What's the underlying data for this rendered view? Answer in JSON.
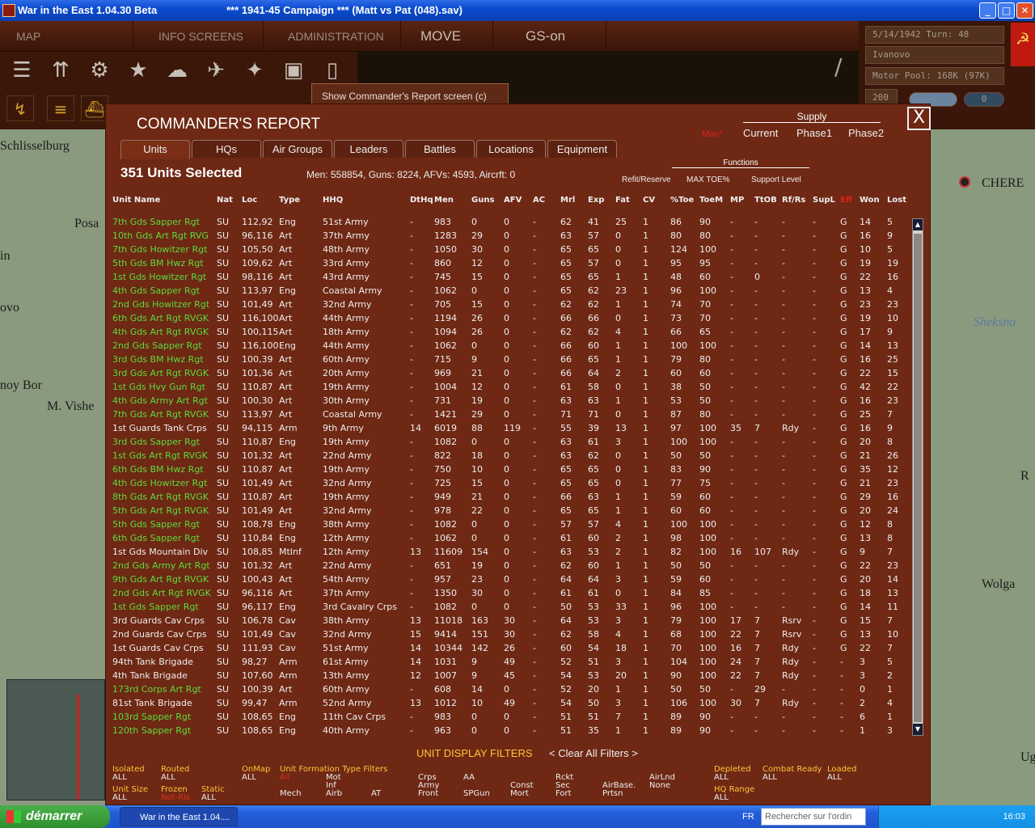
{
  "window": {
    "title_left": "War in the East 1.04.30 Beta",
    "title_right": "***   1941-45 Campaign   ***  (Matt vs Pat (048).sav)"
  },
  "menu": {
    "tabs": [
      "MAP INFORMATION",
      "INFO SCREENS",
      "ADMINISTRATION",
      "MOVE",
      "GS-on"
    ]
  },
  "status": {
    "date_turn": "5/14/1942     Turn: 48",
    "commander": "Ivanovo",
    "motor_pool": "Motor Pool: 168K (97K)",
    "value": "200",
    "counter": "0"
  },
  "tooltip": "Show Commander's Report screen (c)",
  "map": {
    "labels": [
      "Schlisselburg",
      "Posa",
      "ovo",
      "in",
      "noy Bor",
      "M. Vishe",
      "CHERE",
      "Sheksna",
      "Wolga",
      "R",
      "Ug"
    ]
  },
  "report": {
    "title": "COMMANDER'S REPORT",
    "close": "X",
    "supply_header": "Supply",
    "man": "Man*",
    "supply_cols": [
      "Current",
      "Phase1",
      "Phase2"
    ],
    "tabs": [
      "Units",
      "HQs",
      "Air Groups",
      "Leaders",
      "Battles",
      "Locations",
      "Equipment"
    ],
    "selected": "351 Units Selected",
    "totals": "Men: 558854, Guns: 8224, AFVs: 4593, Aircrft: 0",
    "functions_header": "Functions",
    "functions": [
      "Refit/Reserve",
      "MAX TOE%",
      "Support Level"
    ],
    "columns": [
      "Unit Name",
      "Nat",
      "Loc",
      "Type",
      "HHQ",
      "DtHq",
      "Men",
      "Guns",
      "AFV",
      "AC",
      "Mrl",
      "Exp",
      "Fat",
      "CV",
      "%Toe",
      "ToeM",
      "MP",
      "TtOB",
      "Rf/Rs",
      "SupL",
      "Eff",
      "Won",
      "Lost"
    ],
    "rows": [
      [
        "7th Gds Sapper Rgt",
        "SU",
        "112,92",
        "Eng",
        "51st Army",
        "-",
        "983",
        "0",
        "0",
        "-",
        "62",
        "41",
        "25",
        "1",
        "86",
        "90",
        "-",
        "-",
        "-",
        "-",
        "G",
        "14",
        "5"
      ],
      [
        "10th Gds Art Rgt RVG",
        "SU",
        "96,116",
        "Art",
        "37th Army",
        "-",
        "1283",
        "29",
        "0",
        "-",
        "63",
        "57",
        "0",
        "1",
        "80",
        "80",
        "-",
        "-",
        "-",
        "-",
        "G",
        "16",
        "9"
      ],
      [
        "7th Gds Howitzer Rgt",
        "SU",
        "105,50",
        "Art",
        "48th Army",
        "-",
        "1050",
        "30",
        "0",
        "-",
        "65",
        "65",
        "0",
        "1",
        "124",
        "100",
        "-",
        "-",
        "-",
        "-",
        "G",
        "10",
        "5"
      ],
      [
        "5th Gds BM Hwz Rgt",
        "SU",
        "109,62",
        "Art",
        "33rd Army",
        "-",
        "860",
        "12",
        "0",
        "-",
        "65",
        "57",
        "0",
        "1",
        "95",
        "95",
        "-",
        "-",
        "-",
        "-",
        "G",
        "19",
        "19"
      ],
      [
        "1st Gds Howitzer Rgt",
        "SU",
        "98,116",
        "Art",
        "43rd Army",
        "-",
        "745",
        "15",
        "0",
        "-",
        "65",
        "65",
        "1",
        "1",
        "48",
        "60",
        "-",
        "0",
        "-",
        "-",
        "G",
        "22",
        "16"
      ],
      [
        "4th Gds Sapper Rgt",
        "SU",
        "113,97",
        "Eng",
        "Coastal Army",
        "-",
        "1062",
        "0",
        "0",
        "-",
        "65",
        "62",
        "23",
        "1",
        "96",
        "100",
        "-",
        "-",
        "-",
        "-",
        "G",
        "13",
        "4"
      ],
      [
        "2nd Gds Howitzer Rgt",
        "SU",
        "101,49",
        "Art",
        "32nd Army",
        "-",
        "705",
        "15",
        "0",
        "-",
        "62",
        "62",
        "1",
        "1",
        "74",
        "70",
        "-",
        "-",
        "-",
        "-",
        "G",
        "23",
        "23"
      ],
      [
        "6th Gds Art Rgt RVGK",
        "SU",
        "116,100",
        "Art",
        "44th Army",
        "-",
        "1194",
        "26",
        "0",
        "-",
        "66",
        "66",
        "0",
        "1",
        "73",
        "70",
        "-",
        "-",
        "-",
        "-",
        "G",
        "19",
        "10"
      ],
      [
        "4th Gds Art Rgt RVGK",
        "SU",
        "100,115",
        "Art",
        "18th Army",
        "-",
        "1094",
        "26",
        "0",
        "-",
        "62",
        "62",
        "4",
        "1",
        "66",
        "65",
        "-",
        "-",
        "-",
        "-",
        "G",
        "17",
        "9"
      ],
      [
        "2nd Gds Sapper Rgt",
        "SU",
        "116,100",
        "Eng",
        "44th Army",
        "-",
        "1062",
        "0",
        "0",
        "-",
        "66",
        "60",
        "1",
        "1",
        "100",
        "100",
        "-",
        "-",
        "-",
        "-",
        "G",
        "14",
        "13"
      ],
      [
        "3rd Gds BM Hwz Rgt",
        "SU",
        "100,39",
        "Art",
        "60th Army",
        "-",
        "715",
        "9",
        "0",
        "-",
        "66",
        "65",
        "1",
        "1",
        "79",
        "80",
        "-",
        "-",
        "-",
        "-",
        "G",
        "16",
        "25"
      ],
      [
        "3rd Gds Art Rgt RVGK",
        "SU",
        "101,36",
        "Art",
        "20th Army",
        "-",
        "969",
        "21",
        "0",
        "-",
        "66",
        "64",
        "2",
        "1",
        "60",
        "60",
        "-",
        "-",
        "-",
        "-",
        "G",
        "22",
        "15"
      ],
      [
        "1st Gds Hvy Gun Rgt",
        "SU",
        "110,87",
        "Art",
        "19th Army",
        "-",
        "1004",
        "12",
        "0",
        "-",
        "61",
        "58",
        "0",
        "1",
        "38",
        "50",
        "-",
        "-",
        "-",
        "-",
        "G",
        "42",
        "22"
      ],
      [
        "4th Gds Army Art Rgt",
        "SU",
        "100,30",
        "Art",
        "30th Army",
        "-",
        "731",
        "19",
        "0",
        "-",
        "63",
        "63",
        "1",
        "1",
        "53",
        "50",
        "-",
        "-",
        "-",
        "-",
        "G",
        "16",
        "23"
      ],
      [
        "7th Gds Art Rgt RVGK",
        "SU",
        "113,97",
        "Art",
        "Coastal Army",
        "-",
        "1421",
        "29",
        "0",
        "-",
        "71",
        "71",
        "0",
        "1",
        "87",
        "80",
        "-",
        "-",
        "-",
        "-",
        "G",
        "25",
        "7"
      ],
      [
        "1st Guards Tank Crps",
        "SU",
        "94,115",
        "Arm",
        "9th Army",
        "14",
        "6019",
        "88",
        "119",
        "-",
        "55",
        "39",
        "13",
        "1",
        "97",
        "100",
        "35",
        "7",
        "Rdy",
        "-",
        "G",
        "16",
        "9"
      ],
      [
        "3rd Gds Sapper Rgt",
        "SU",
        "110,87",
        "Eng",
        "19th Army",
        "-",
        "1082",
        "0",
        "0",
        "-",
        "63",
        "61",
        "3",
        "1",
        "100",
        "100",
        "-",
        "-",
        "-",
        "-",
        "G",
        "20",
        "8"
      ],
      [
        "1st Gds Art Rgt RVGK",
        "SU",
        "101,32",
        "Art",
        "22nd Army",
        "-",
        "822",
        "18",
        "0",
        "-",
        "63",
        "62",
        "0",
        "1",
        "50",
        "50",
        "-",
        "-",
        "-",
        "-",
        "G",
        "21",
        "26"
      ],
      [
        "6th Gds BM Hwz Rgt",
        "SU",
        "110,87",
        "Art",
        "19th Army",
        "-",
        "750",
        "10",
        "0",
        "-",
        "65",
        "65",
        "0",
        "1",
        "83",
        "90",
        "-",
        "-",
        "-",
        "-",
        "G",
        "35",
        "12"
      ],
      [
        "4th Gds Howitzer Rgt",
        "SU",
        "101,49",
        "Art",
        "32nd Army",
        "-",
        "725",
        "15",
        "0",
        "-",
        "65",
        "65",
        "0",
        "1",
        "77",
        "75",
        "-",
        "-",
        "-",
        "-",
        "G",
        "21",
        "23"
      ],
      [
        "8th Gds Art Rgt RVGK",
        "SU",
        "110,87",
        "Art",
        "19th Army",
        "-",
        "949",
        "21",
        "0",
        "-",
        "66",
        "63",
        "1",
        "1",
        "59",
        "60",
        "-",
        "-",
        "-",
        "-",
        "G",
        "29",
        "16"
      ],
      [
        "5th Gds Art Rgt RVGK",
        "SU",
        "101,49",
        "Art",
        "32nd Army",
        "-",
        "978",
        "22",
        "0",
        "-",
        "65",
        "65",
        "1",
        "1",
        "60",
        "60",
        "-",
        "-",
        "-",
        "-",
        "G",
        "20",
        "24"
      ],
      [
        "5th Gds Sapper Rgt",
        "SU",
        "108,78",
        "Eng",
        "38th Army",
        "-",
        "1082",
        "0",
        "0",
        "-",
        "57",
        "57",
        "4",
        "1",
        "100",
        "100",
        "-",
        "-",
        "-",
        "-",
        "G",
        "12",
        "8"
      ],
      [
        "6th Gds Sapper Rgt",
        "SU",
        "110,84",
        "Eng",
        "12th Army",
        "-",
        "1062",
        "0",
        "0",
        "-",
        "61",
        "60",
        "2",
        "1",
        "98",
        "100",
        "-",
        "-",
        "-",
        "-",
        "G",
        "13",
        "8"
      ],
      [
        "1st Gds Mountain Div",
        "SU",
        "108,85",
        "MtInf",
        "12th Army",
        "13",
        "11609",
        "154",
        "0",
        "-",
        "63",
        "53",
        "2",
        "1",
        "82",
        "100",
        "16",
        "107",
        "Rdy",
        "-",
        "G",
        "9",
        "7"
      ],
      [
        "2nd Gds Army Art Rgt",
        "SU",
        "101,32",
        "Art",
        "22nd Army",
        "-",
        "651",
        "19",
        "0",
        "-",
        "62",
        "60",
        "1",
        "1",
        "50",
        "50",
        "-",
        "-",
        "-",
        "-",
        "G",
        "22",
        "23"
      ],
      [
        "9th Gds Art Rgt RVGK",
        "SU",
        "100,43",
        "Art",
        "54th Army",
        "-",
        "957",
        "23",
        "0",
        "-",
        "64",
        "64",
        "3",
        "1",
        "59",
        "60",
        "-",
        "-",
        "-",
        "-",
        "G",
        "20",
        "14"
      ],
      [
        "2nd Gds Art Rgt RVGK",
        "SU",
        "96,116",
        "Art",
        "37th Army",
        "-",
        "1350",
        "30",
        "0",
        "-",
        "61",
        "61",
        "0",
        "1",
        "84",
        "85",
        "-",
        "-",
        "-",
        "-",
        "G",
        "18",
        "13"
      ],
      [
        "1st Gds Sapper Rgt",
        "SU",
        "96,117",
        "Eng",
        "3rd Cavalry Crps",
        "-",
        "1082",
        "0",
        "0",
        "-",
        "50",
        "53",
        "33",
        "1",
        "96",
        "100",
        "-",
        "-",
        "-",
        "-",
        "G",
        "14",
        "11"
      ],
      [
        "3rd Guards Cav Crps",
        "SU",
        "106,78",
        "Cav",
        "38th Army",
        "13",
        "11018",
        "163",
        "30",
        "-",
        "64",
        "53",
        "3",
        "1",
        "79",
        "100",
        "17",
        "7",
        "Rsrv",
        "-",
        "G",
        "15",
        "7"
      ],
      [
        "2nd Guards Cav Crps",
        "SU",
        "101,49",
        "Cav",
        "32nd Army",
        "15",
        "9414",
        "151",
        "30",
        "-",
        "62",
        "58",
        "4",
        "1",
        "68",
        "100",
        "22",
        "7",
        "Rsrv",
        "-",
        "G",
        "13",
        "10"
      ],
      [
        "1st Guards Cav Crps",
        "SU",
        "111,93",
        "Cav",
        "51st Army",
        "14",
        "10344",
        "142",
        "26",
        "-",
        "60",
        "54",
        "18",
        "1",
        "70",
        "100",
        "16",
        "7",
        "Rdy",
        "-",
        "G",
        "22",
        "7"
      ],
      [
        "94th Tank Brigade",
        "SU",
        "98,27",
        "Arm",
        "61st Army",
        "14",
        "1031",
        "9",
        "49",
        "-",
        "52",
        "51",
        "3",
        "1",
        "104",
        "100",
        "24",
        "7",
        "Rdy",
        "-",
        "-",
        "3",
        "5"
      ],
      [
        "4th Tank Brigade",
        "SU",
        "107,60",
        "Arm",
        "13th Army",
        "12",
        "1007",
        "9",
        "45",
        "-",
        "54",
        "53",
        "20",
        "1",
        "90",
        "100",
        "22",
        "7",
        "Rdy",
        "-",
        "-",
        "3",
        "2"
      ],
      [
        "173rd Corps Art Rgt",
        "SU",
        "100,39",
        "Art",
        "60th Army",
        "-",
        "608",
        "14",
        "0",
        "-",
        "52",
        "20",
        "1",
        "1",
        "50",
        "50",
        "-",
        "29",
        "-",
        "-",
        "-",
        "0",
        "1"
      ],
      [
        "81st Tank Brigade",
        "SU",
        "99,47",
        "Arm",
        "52nd Army",
        "13",
        "1012",
        "10",
        "49",
        "-",
        "54",
        "50",
        "3",
        "1",
        "106",
        "100",
        "30",
        "7",
        "Rdy",
        "-",
        "-",
        "2",
        "4"
      ],
      [
        "103rd Sapper Rgt",
        "SU",
        "108,65",
        "Eng",
        "11th Cav Crps",
        "-",
        "983",
        "0",
        "0",
        "-",
        "51",
        "51",
        "7",
        "1",
        "89",
        "90",
        "-",
        "-",
        "-",
        "-",
        "-",
        "6",
        "1"
      ],
      [
        "120th Sapper Rgt",
        "SU",
        "108,65",
        "Eng",
        "40th Army",
        "-",
        "963",
        "0",
        "0",
        "-",
        "51",
        "35",
        "1",
        "1",
        "89",
        "90",
        "-",
        "-",
        "-",
        "-",
        "-",
        "1",
        "3"
      ]
    ],
    "green_rows": [
      0,
      1,
      2,
      3,
      4,
      5,
      6,
      7,
      8,
      9,
      10,
      11,
      12,
      13,
      14,
      16,
      17,
      18,
      19,
      20,
      21,
      22,
      23,
      25,
      26,
      27,
      28,
      34,
      36,
      37
    ],
    "filters": {
      "title": "UNIT DISPLAY FILTERS",
      "clear": "< Clear All Filters >",
      "isolated": "Isolated",
      "isolated_v": "ALL",
      "routed": "Routed",
      "routed_v": "ALL",
      "onmap": "OnMap",
      "onmap_v": "ALL",
      "formation": "Unit  Formation  Type   Filters",
      "all": "All",
      "mech": "Mech",
      "mot": "Mot",
      "inf": "Inf",
      "airb": "Airb",
      "at": "AT",
      "crps": "Crps",
      "army": "Army",
      "front": "Front",
      "aa": "AA",
      "spgun": "SPGun",
      "const": "Const",
      "mort": "Mort",
      "rckt": "Rckt",
      "sec": "Sec",
      "fort": "Fort",
      "airbase": "AirBase.",
      "prtsn": "Prtsn",
      "airlnd": "AirLnd",
      "none": "None",
      "depleted": "Depleted",
      "depleted_v": "ALL",
      "combat": "Combat Ready",
      "combat_v": "ALL",
      "loaded": "Loaded",
      "loaded_v": "ALL",
      "unitsize": "Unit Size",
      "unitsize_v": "ALL",
      "frozen": "Frozen",
      "frozen_v": "Not-Rls",
      "static": "Static",
      "static_v": "ALL",
      "hqrange": "HQ Range",
      "hqrange_v": "ALL"
    }
  },
  "taskbar": {
    "start": "démarrer",
    "task": "War in the East 1.04....",
    "lang": "FR",
    "search": "Rechercher sur l'ordin",
    "clock": "16:03"
  },
  "colors": {
    "report_bg": "#6e2814",
    "green_text": "#5cdc3c",
    "filter_yellow": "#ffc636",
    "filter_red": "#e03020"
  }
}
